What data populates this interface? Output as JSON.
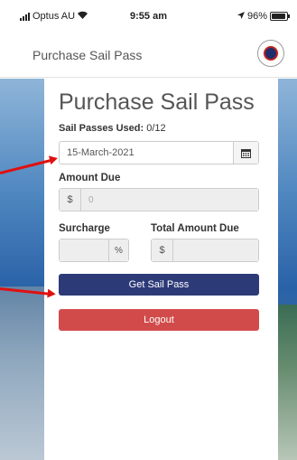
{
  "status_bar": {
    "carrier": "Optus AU",
    "time": "9:55 am",
    "battery": "96%",
    "battery_level": 0.96,
    "icons": [
      "signal-icon",
      "wifi-icon",
      "location-icon",
      "battery-icon"
    ]
  },
  "header": {
    "title": "Purchase Sail Pass",
    "logo": "club-logo-icon"
  },
  "card": {
    "title": "Purchase Sail Pass",
    "passes_used_label": "Sail Passes Used:",
    "passes_used_value": "0/12",
    "date_value": "15-March-2021",
    "calendar_icon": "calendar-icon",
    "amount_label": "Amount Due",
    "amount_addon": "$",
    "amount_value": "0",
    "surcharge_label": "Surcharge",
    "surcharge_addon": "%",
    "total_label": "Total Amount Due",
    "total_addon": "$",
    "get_pass_label": "Get Sail Pass",
    "logout_label": "Logout"
  },
  "colors": {
    "primary_button": "#2d3a78",
    "logout_button": "#d24b4b",
    "annotation_arrow": "#e01010"
  }
}
